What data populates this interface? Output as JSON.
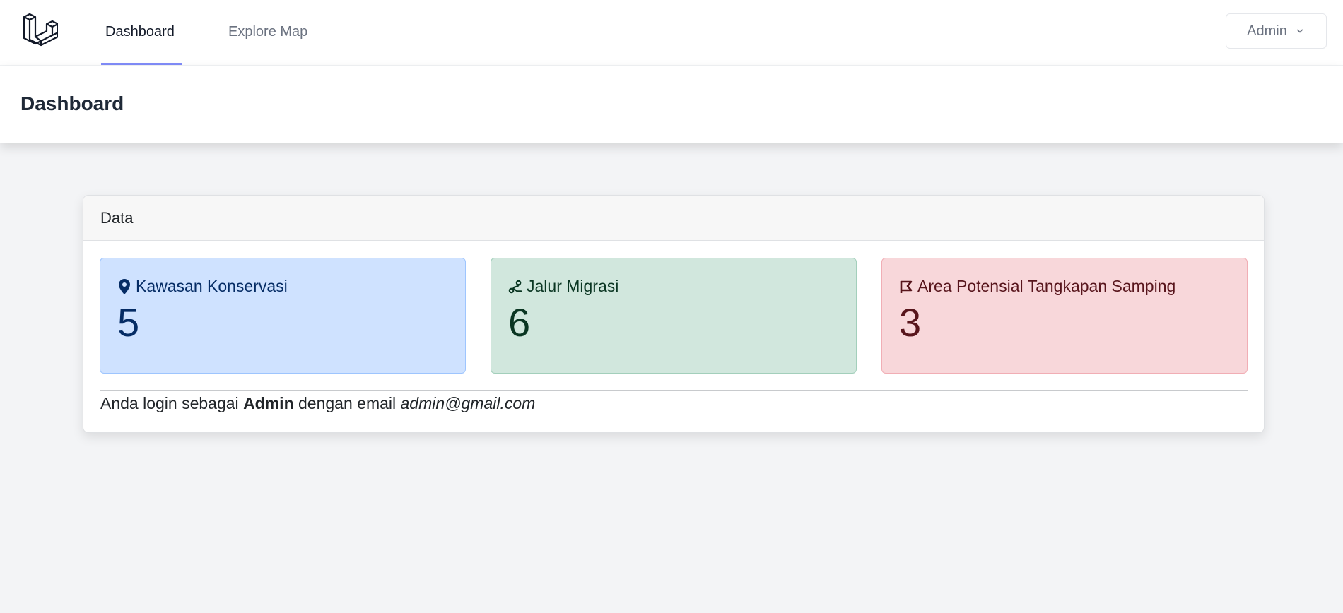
{
  "nav": {
    "links": [
      {
        "label": "Dashboard",
        "active": true
      },
      {
        "label": "Explore Map",
        "active": false
      }
    ],
    "user_label": "Admin"
  },
  "header": {
    "title": "Dashboard"
  },
  "card": {
    "title": "Data",
    "tiles": [
      {
        "label": "Kawasan Konservasi",
        "count": "5",
        "icon": "map-marker-icon"
      },
      {
        "label": "Jalur Migrasi",
        "count": "6",
        "icon": "route-icon"
      },
      {
        "label": "Area Potensial Tangkapan Samping",
        "count": "3",
        "icon": "flag-icon"
      }
    ],
    "footer": {
      "prefix": "Anda login sebagai",
      "user": "Admin",
      "middle": "dengan email",
      "email": "admin@gmail.com"
    }
  },
  "colors": {
    "accent_underline": "#818cf8",
    "tile_blue": "#cfe2ff",
    "tile_green": "#d1e7dd",
    "tile_red": "#f8d7da"
  }
}
